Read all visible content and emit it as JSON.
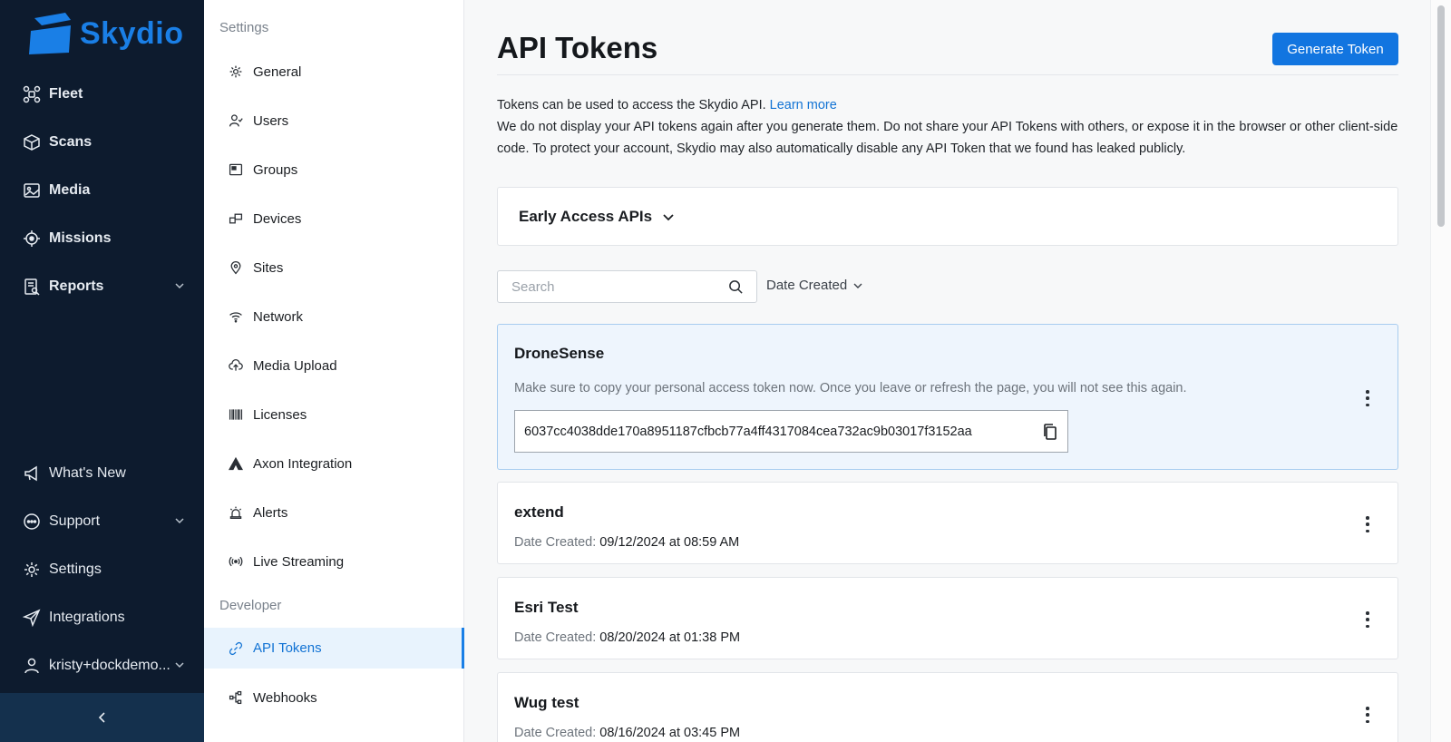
{
  "brand": {
    "name": "Skydio",
    "color": "#1a7fe6"
  },
  "nav": {
    "items": [
      {
        "label": "Fleet",
        "icon": "drone-icon"
      },
      {
        "label": "Scans",
        "icon": "cube-icon"
      },
      {
        "label": "Media",
        "icon": "image-icon"
      },
      {
        "label": "Missions",
        "icon": "target-icon"
      },
      {
        "label": "Reports",
        "icon": "report-icon"
      }
    ],
    "bottom_items": [
      {
        "label": "What's New",
        "icon": "megaphone-icon"
      },
      {
        "label": "Support",
        "icon": "chat-icon"
      },
      {
        "label": "Settings",
        "icon": "gear-icon"
      },
      {
        "label": "Integrations",
        "icon": "send-icon"
      },
      {
        "label": "kristy+dockdemo...",
        "icon": "user-icon"
      }
    ]
  },
  "settings_nav": {
    "heading": "Settings",
    "items": [
      {
        "label": "General",
        "icon": "gear-icon"
      },
      {
        "label": "Users",
        "icon": "users-icon"
      },
      {
        "label": "Groups",
        "icon": "group-icon"
      },
      {
        "label": "Devices",
        "icon": "devices-icon"
      },
      {
        "label": "Sites",
        "icon": "pin-icon"
      },
      {
        "label": "Network",
        "icon": "wifi-icon"
      },
      {
        "label": "Media Upload",
        "icon": "cloud-upload-icon"
      },
      {
        "label": "Licenses",
        "icon": "barcode-icon"
      },
      {
        "label": "Axon Integration",
        "icon": "axon-icon"
      },
      {
        "label": "Alerts",
        "icon": "siren-icon"
      },
      {
        "label": "Live Streaming",
        "icon": "broadcast-icon"
      }
    ],
    "developer_heading": "Developer",
    "developer_items": [
      {
        "label": "API Tokens",
        "icon": "link-icon",
        "active": true
      },
      {
        "label": "Webhooks",
        "icon": "webhook-icon"
      }
    ]
  },
  "main": {
    "title": "API Tokens",
    "generate_label": "Generate Token",
    "intro_line1": "Tokens can be used to access the Skydio API.",
    "learn_more": "Learn more",
    "intro_line2": "We do not display your API tokens again after you generate them. Do not share your API Tokens with others, or expose it in the browser or other client-side code. To protect your account, Skydio may also automatically disable any API Token that we found has leaked publicly.",
    "early_access_label": "Early Access APIs",
    "search_placeholder": "Search",
    "sort_label": "Date Created",
    "new_token": {
      "name": "DroneSense",
      "note": "Make sure to copy your personal access token now. Once you leave or refresh the page, you will not see this again.",
      "token": "6037cc4038dde170a8951187cfbcb77a4ff4317084cea732ac9b03017f3152aa"
    },
    "date_label": "Date Created:",
    "tokens": [
      {
        "name": "extend",
        "date": "09/12/2024 at 08:59 AM"
      },
      {
        "name": "Esri Test",
        "date": "08/20/2024 at 01:38 PM"
      },
      {
        "name": "Wug test",
        "date": "08/16/2024 at 03:45 PM"
      }
    ]
  }
}
